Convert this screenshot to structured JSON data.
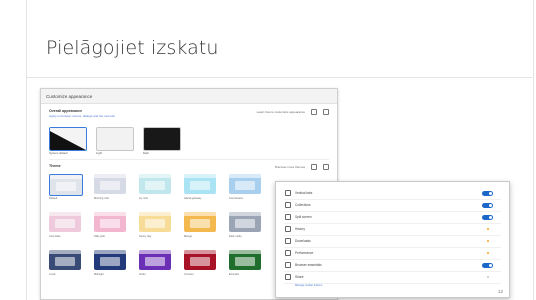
{
  "slide": {
    "title": "Pielāgojiet izskatu",
    "page_number": "12"
  },
  "appearance_panel": {
    "header": "Customize appearance",
    "overall_section": "Overall appearance",
    "overall_sub": "Apply to browser menus, dialogs and the new tab",
    "overall_right_label": "Learn how to customize appearance",
    "modes": [
      {
        "label": "System default"
      },
      {
        "label": "Light"
      },
      {
        "label": "Dark"
      }
    ],
    "theme_section": "Theme",
    "theme_right_label": "Discover more themes",
    "themes": [
      {
        "label": "Default",
        "color": "#dfe3ea"
      },
      {
        "label": "Morning mist",
        "color": "#d6d9e6"
      },
      {
        "label": "Icy mint",
        "color": "#bfe7ec"
      },
      {
        "label": "Island getaway",
        "color": "#a9e3f4"
      },
      {
        "label": "Cool breeze",
        "color": "#a9cfee"
      },
      {
        "label": "Cool slate",
        "color": "#eecadc"
      },
      {
        "label": "Silky pink",
        "color": "#f3b6cf"
      },
      {
        "label": "Sunny day",
        "color": "#f6dc96"
      },
      {
        "label": "Mango",
        "color": "#f3b94f"
      },
      {
        "label": "Dark mode",
        "color": "#9aa4b5"
      },
      {
        "label": "Lunar",
        "color": "#384a76"
      },
      {
        "label": "Midnight",
        "color": "#223a7a"
      },
      {
        "label": "Violet",
        "color": "#6b2fb5"
      },
      {
        "label": "Crimson",
        "color": "#a81227"
      },
      {
        "label": "Emerald",
        "color": "#1f6e2d"
      }
    ]
  },
  "settings_panel": {
    "rows": [
      {
        "label": "Vertical tabs",
        "control": "toggle"
      },
      {
        "label": "Collections",
        "control": "toggle"
      },
      {
        "label": "Split screen",
        "control": "toggle"
      },
      {
        "label": "History",
        "control": "dot"
      },
      {
        "label": "Downloads",
        "control": "dot"
      },
      {
        "label": "Performance",
        "control": "dot"
      },
      {
        "label": "Browser essentials",
        "control": "toggle"
      },
      {
        "label": "Share",
        "control": "dot-grey"
      }
    ],
    "last_row_link": "Manage toolbar buttons"
  }
}
